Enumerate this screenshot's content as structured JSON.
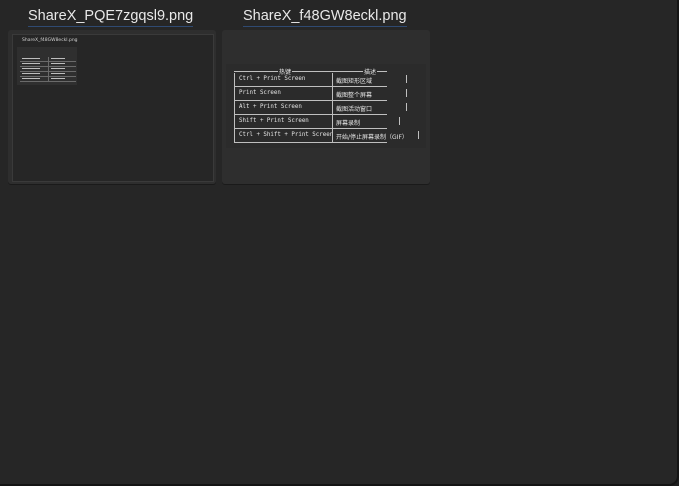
{
  "gallery": {
    "items": [
      {
        "filename": "ShareX_PQE7zgqsl9.png",
        "nested_label": "ShareX_f48GW8eckl.png"
      },
      {
        "filename": "ShareX_f48GW8eckl.png",
        "table": {
          "header_hotkey": "热键",
          "header_desc": "描述",
          "rows": [
            {
              "hotkey": "Ctrl + Print Screen",
              "desc": "截图矩形区域"
            },
            {
              "hotkey": "Print Screen",
              "desc": "截图整个屏幕"
            },
            {
              "hotkey": "Alt + Print Screen",
              "desc": "截图活动窗口"
            },
            {
              "hotkey": "Shift + Print Screen",
              "desc": "屏幕录制"
            },
            {
              "hotkey": "Ctrl + Shift + Print Screen",
              "desc": "开始/停止屏幕录制（GIF）"
            }
          ]
        }
      }
    ]
  },
  "colors": {
    "background": "#262626",
    "thumbnail": "#2e2e2e",
    "text": "#e9e9e9",
    "underline_accent": "#2f4a72"
  }
}
